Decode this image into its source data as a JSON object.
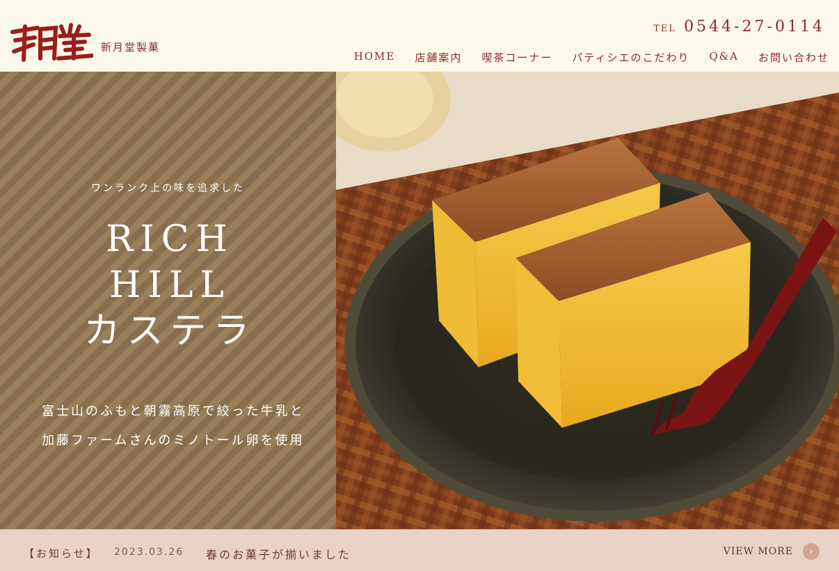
{
  "header": {
    "logo_text": "新月堂製菓",
    "tel_label": "TEL",
    "tel_number": "0544-27-0114",
    "nav": [
      "HOME",
      "店舗案内",
      "喫茶コーナー",
      "パティシエのこだわり",
      "Q&A",
      "お問い合わせ"
    ]
  },
  "hero": {
    "tagline": "ワンランク上の味を追求した",
    "title_lines": [
      "RICH",
      "HILL",
      "カステラ"
    ],
    "lead_lines": [
      "富士山のふもと朝霧高原で絞った牛乳と",
      "加藤ファームさんのミノトール卵を使用"
    ]
  },
  "news": {
    "label": "【お知らせ】",
    "date": "2023.03.26",
    "title": "春のお菓子が揃いました",
    "more_label": "VIEW MORE",
    "more_icon": "chevron-right-icon"
  },
  "colors": {
    "brand": "#8a2a2a",
    "stripe_dark": "#8c7254",
    "stripe_light": "#a08762",
    "news_bg": "#ead2c7"
  }
}
